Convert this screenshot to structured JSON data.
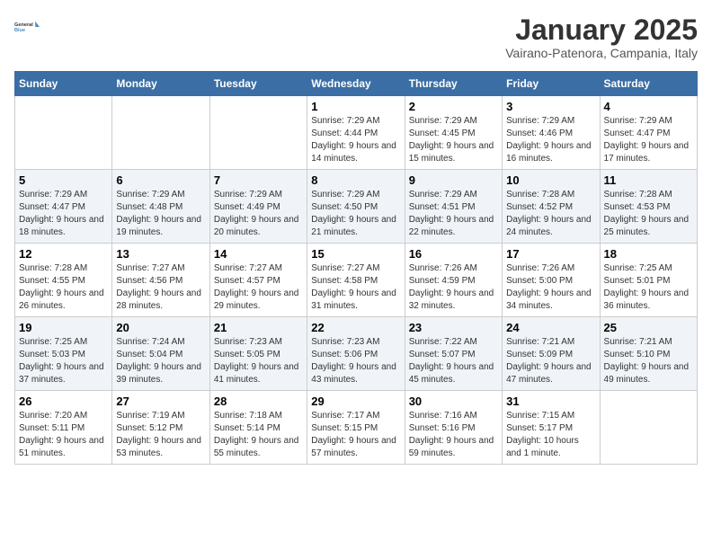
{
  "logo": {
    "line1": "General",
    "line2": "Blue"
  },
  "title": "January 2025",
  "subtitle": "Vairano-Patenora, Campania, Italy",
  "days_header": [
    "Sunday",
    "Monday",
    "Tuesday",
    "Wednesday",
    "Thursday",
    "Friday",
    "Saturday"
  ],
  "weeks": [
    [
      {
        "day": "",
        "info": ""
      },
      {
        "day": "",
        "info": ""
      },
      {
        "day": "",
        "info": ""
      },
      {
        "day": "1",
        "info": "Sunrise: 7:29 AM\nSunset: 4:44 PM\nDaylight: 9 hours\nand 14 minutes."
      },
      {
        "day": "2",
        "info": "Sunrise: 7:29 AM\nSunset: 4:45 PM\nDaylight: 9 hours\nand 15 minutes."
      },
      {
        "day": "3",
        "info": "Sunrise: 7:29 AM\nSunset: 4:46 PM\nDaylight: 9 hours\nand 16 minutes."
      },
      {
        "day": "4",
        "info": "Sunrise: 7:29 AM\nSunset: 4:47 PM\nDaylight: 9 hours\nand 17 minutes."
      }
    ],
    [
      {
        "day": "5",
        "info": "Sunrise: 7:29 AM\nSunset: 4:47 PM\nDaylight: 9 hours\nand 18 minutes."
      },
      {
        "day": "6",
        "info": "Sunrise: 7:29 AM\nSunset: 4:48 PM\nDaylight: 9 hours\nand 19 minutes."
      },
      {
        "day": "7",
        "info": "Sunrise: 7:29 AM\nSunset: 4:49 PM\nDaylight: 9 hours\nand 20 minutes."
      },
      {
        "day": "8",
        "info": "Sunrise: 7:29 AM\nSunset: 4:50 PM\nDaylight: 9 hours\nand 21 minutes."
      },
      {
        "day": "9",
        "info": "Sunrise: 7:29 AM\nSunset: 4:51 PM\nDaylight: 9 hours\nand 22 minutes."
      },
      {
        "day": "10",
        "info": "Sunrise: 7:28 AM\nSunset: 4:52 PM\nDaylight: 9 hours\nand 24 minutes."
      },
      {
        "day": "11",
        "info": "Sunrise: 7:28 AM\nSunset: 4:53 PM\nDaylight: 9 hours\nand 25 minutes."
      }
    ],
    [
      {
        "day": "12",
        "info": "Sunrise: 7:28 AM\nSunset: 4:55 PM\nDaylight: 9 hours\nand 26 minutes."
      },
      {
        "day": "13",
        "info": "Sunrise: 7:27 AM\nSunset: 4:56 PM\nDaylight: 9 hours\nand 28 minutes."
      },
      {
        "day": "14",
        "info": "Sunrise: 7:27 AM\nSunset: 4:57 PM\nDaylight: 9 hours\nand 29 minutes."
      },
      {
        "day": "15",
        "info": "Sunrise: 7:27 AM\nSunset: 4:58 PM\nDaylight: 9 hours\nand 31 minutes."
      },
      {
        "day": "16",
        "info": "Sunrise: 7:26 AM\nSunset: 4:59 PM\nDaylight: 9 hours\nand 32 minutes."
      },
      {
        "day": "17",
        "info": "Sunrise: 7:26 AM\nSunset: 5:00 PM\nDaylight: 9 hours\nand 34 minutes."
      },
      {
        "day": "18",
        "info": "Sunrise: 7:25 AM\nSunset: 5:01 PM\nDaylight: 9 hours\nand 36 minutes."
      }
    ],
    [
      {
        "day": "19",
        "info": "Sunrise: 7:25 AM\nSunset: 5:03 PM\nDaylight: 9 hours\nand 37 minutes."
      },
      {
        "day": "20",
        "info": "Sunrise: 7:24 AM\nSunset: 5:04 PM\nDaylight: 9 hours\nand 39 minutes."
      },
      {
        "day": "21",
        "info": "Sunrise: 7:23 AM\nSunset: 5:05 PM\nDaylight: 9 hours\nand 41 minutes."
      },
      {
        "day": "22",
        "info": "Sunrise: 7:23 AM\nSunset: 5:06 PM\nDaylight: 9 hours\nand 43 minutes."
      },
      {
        "day": "23",
        "info": "Sunrise: 7:22 AM\nSunset: 5:07 PM\nDaylight: 9 hours\nand 45 minutes."
      },
      {
        "day": "24",
        "info": "Sunrise: 7:21 AM\nSunset: 5:09 PM\nDaylight: 9 hours\nand 47 minutes."
      },
      {
        "day": "25",
        "info": "Sunrise: 7:21 AM\nSunset: 5:10 PM\nDaylight: 9 hours\nand 49 minutes."
      }
    ],
    [
      {
        "day": "26",
        "info": "Sunrise: 7:20 AM\nSunset: 5:11 PM\nDaylight: 9 hours\nand 51 minutes."
      },
      {
        "day": "27",
        "info": "Sunrise: 7:19 AM\nSunset: 5:12 PM\nDaylight: 9 hours\nand 53 minutes."
      },
      {
        "day": "28",
        "info": "Sunrise: 7:18 AM\nSunset: 5:14 PM\nDaylight: 9 hours\nand 55 minutes."
      },
      {
        "day": "29",
        "info": "Sunrise: 7:17 AM\nSunset: 5:15 PM\nDaylight: 9 hours\nand 57 minutes."
      },
      {
        "day": "30",
        "info": "Sunrise: 7:16 AM\nSunset: 5:16 PM\nDaylight: 9 hours\nand 59 minutes."
      },
      {
        "day": "31",
        "info": "Sunrise: 7:15 AM\nSunset: 5:17 PM\nDaylight: 10 hours\nand 1 minute."
      },
      {
        "day": "",
        "info": ""
      }
    ]
  ]
}
